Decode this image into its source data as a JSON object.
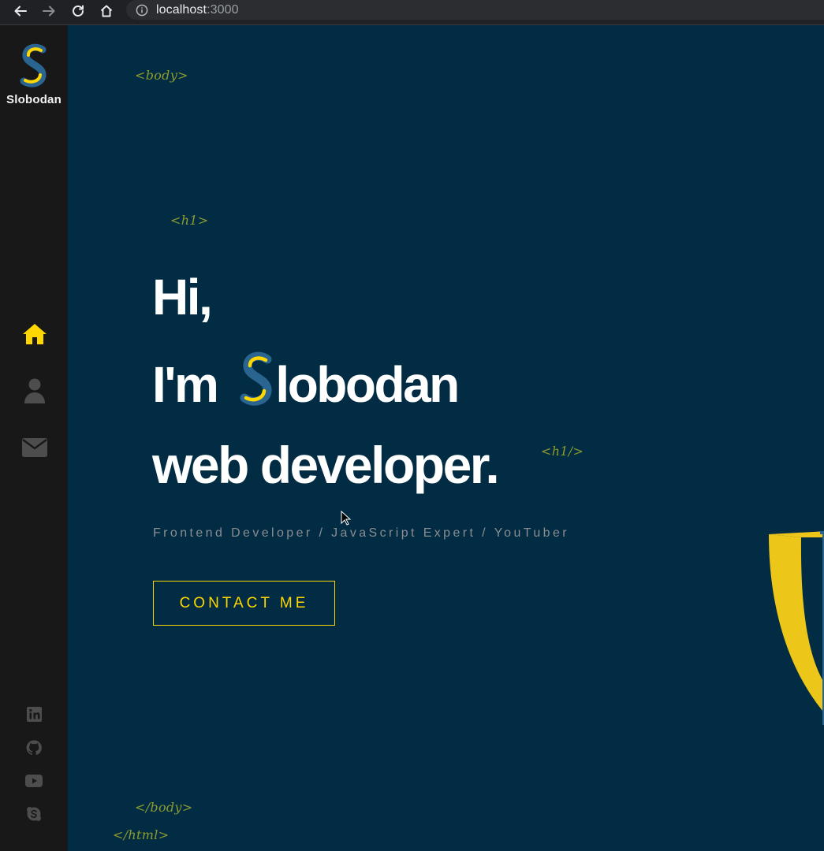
{
  "browser": {
    "url_host": "localhost",
    "url_port": ":3000",
    "icons": [
      "back-arrow-icon",
      "forward-arrow-icon",
      "reload-icon",
      "home-icon",
      "info-icon"
    ]
  },
  "sidebar": {
    "logo_text": "Slobodan",
    "nav": [
      {
        "name": "home",
        "icon": "home-icon",
        "active": true
      },
      {
        "name": "about",
        "icon": "user-icon",
        "active": false
      },
      {
        "name": "contact",
        "icon": "envelope-icon",
        "active": false
      }
    ],
    "socials": [
      "linkedin-icon",
      "github-icon",
      "youtube-icon",
      "skype-icon"
    ]
  },
  "tags": {
    "body_open": "<body>",
    "h1_open": "<h1>",
    "h1_close": "<h1/>",
    "body_close": "</body>",
    "html_close": "</html>"
  },
  "hero": {
    "line1": "Hi,",
    "line2_prefix": "I'm",
    "line2_name_rest": "lobodan",
    "line3": "web developer.",
    "subtitle": "Frontend Developer / JavaScript Expert / YouTuber",
    "cta_label": "CONTACT ME"
  },
  "colors": {
    "background": "#022c43",
    "sidebar": "#181818",
    "accent": "#ffd700",
    "tag": "#8d9b2e",
    "logo_blue": "#2a6490"
  }
}
